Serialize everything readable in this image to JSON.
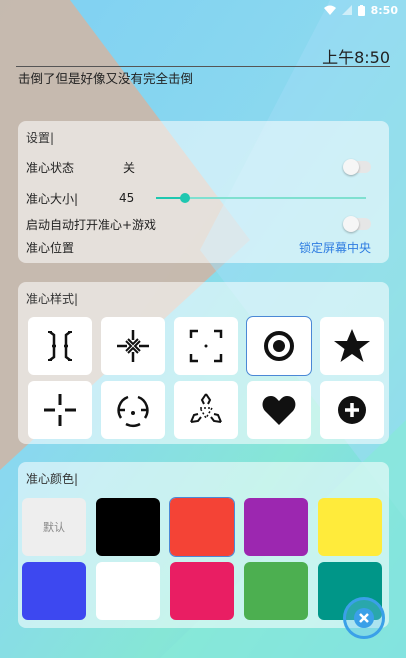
{
  "status_bar": {
    "time": "8:50"
  },
  "header": {
    "clock": "上午8:50",
    "subtitle": "击倒了但是好像又没有完全击倒"
  },
  "settings": {
    "title": "设置|",
    "crosshair_state_label": "准心状态",
    "crosshair_state_value": "关",
    "crosshair_size_label": "准心大小|",
    "crosshair_size_value": "45",
    "crosshair_size_fraction": 0.14,
    "auto_launch_label": "启动自动打开准心+游戏",
    "position_label": "准心位置",
    "position_value": "锁定屏幕中央"
  },
  "style": {
    "title": "准心样式|",
    "selected_index": 3,
    "items": [
      "bracket-crosshair-icon",
      "arrow-cross-crosshair-icon",
      "corner-brackets-crosshair-icon",
      "dot-ring-crosshair-icon",
      "star-icon",
      "gap-cross-crosshair-icon",
      "circle-dot-crosshair-icon",
      "triple-arrow-crosshair-icon",
      "heart-icon",
      "plus-circle-icon"
    ]
  },
  "color": {
    "title": "准心颜色|",
    "default_label": "默认",
    "selected_index": 2,
    "swatches": [
      "#eeeeee",
      "#000000",
      "#f44336",
      "#9c27b0",
      "#ffeb3b",
      "#3d48f0",
      "#ffffff",
      "#e91e63",
      "#4caf50",
      "#009688"
    ]
  }
}
